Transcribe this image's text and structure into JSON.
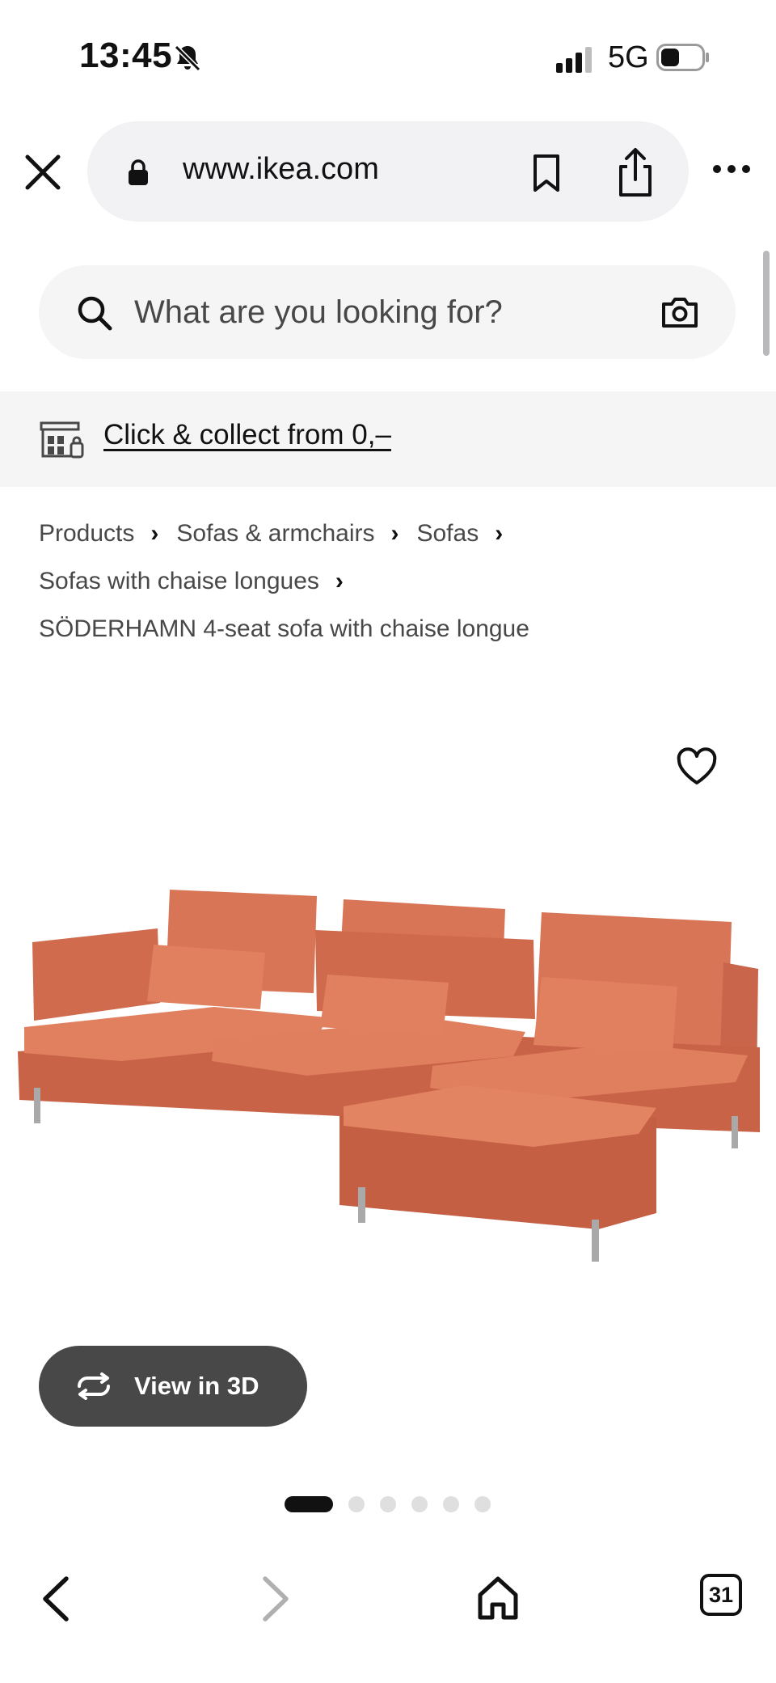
{
  "status_bar": {
    "time": "13:45",
    "network": "5G",
    "icons": [
      "bell-slash-icon",
      "signal-icon",
      "battery-icon"
    ]
  },
  "browser": {
    "url": "www.ikea.com",
    "icons": [
      "close-icon",
      "lock-icon",
      "bookmark-icon",
      "share-icon",
      "more-icon"
    ]
  },
  "search": {
    "placeholder": "What are you looking for?",
    "icons": [
      "search-icon",
      "camera-icon"
    ]
  },
  "collect_banner": {
    "text": "Click & collect from 0,–",
    "icon": "store-icon"
  },
  "breadcrumb": {
    "items": [
      "Products",
      "Sofas & armchairs",
      "Sofas",
      "Sofas with chaise longues"
    ],
    "current": "SÖDERHAMN 4-seat sofa with chaise longue",
    "separator": "›"
  },
  "product": {
    "image_icon": "sofa-image",
    "favourite_icon": "heart-icon",
    "view3d_label": "View in 3D",
    "view3d_icon": "rotate-icon",
    "sofa_color": "#d9795a"
  },
  "carousel": {
    "total": 6,
    "active_index": 0
  },
  "toolbar": {
    "tab_count": "31",
    "icons": [
      "back-icon",
      "forward-icon",
      "home-icon",
      "tabs-icon"
    ]
  },
  "colors": {
    "pill_bg": "#f2f2f4",
    "banner_bg": "#f5f5f5",
    "button_dark": "#484848",
    "text_secondary": "#484848"
  }
}
